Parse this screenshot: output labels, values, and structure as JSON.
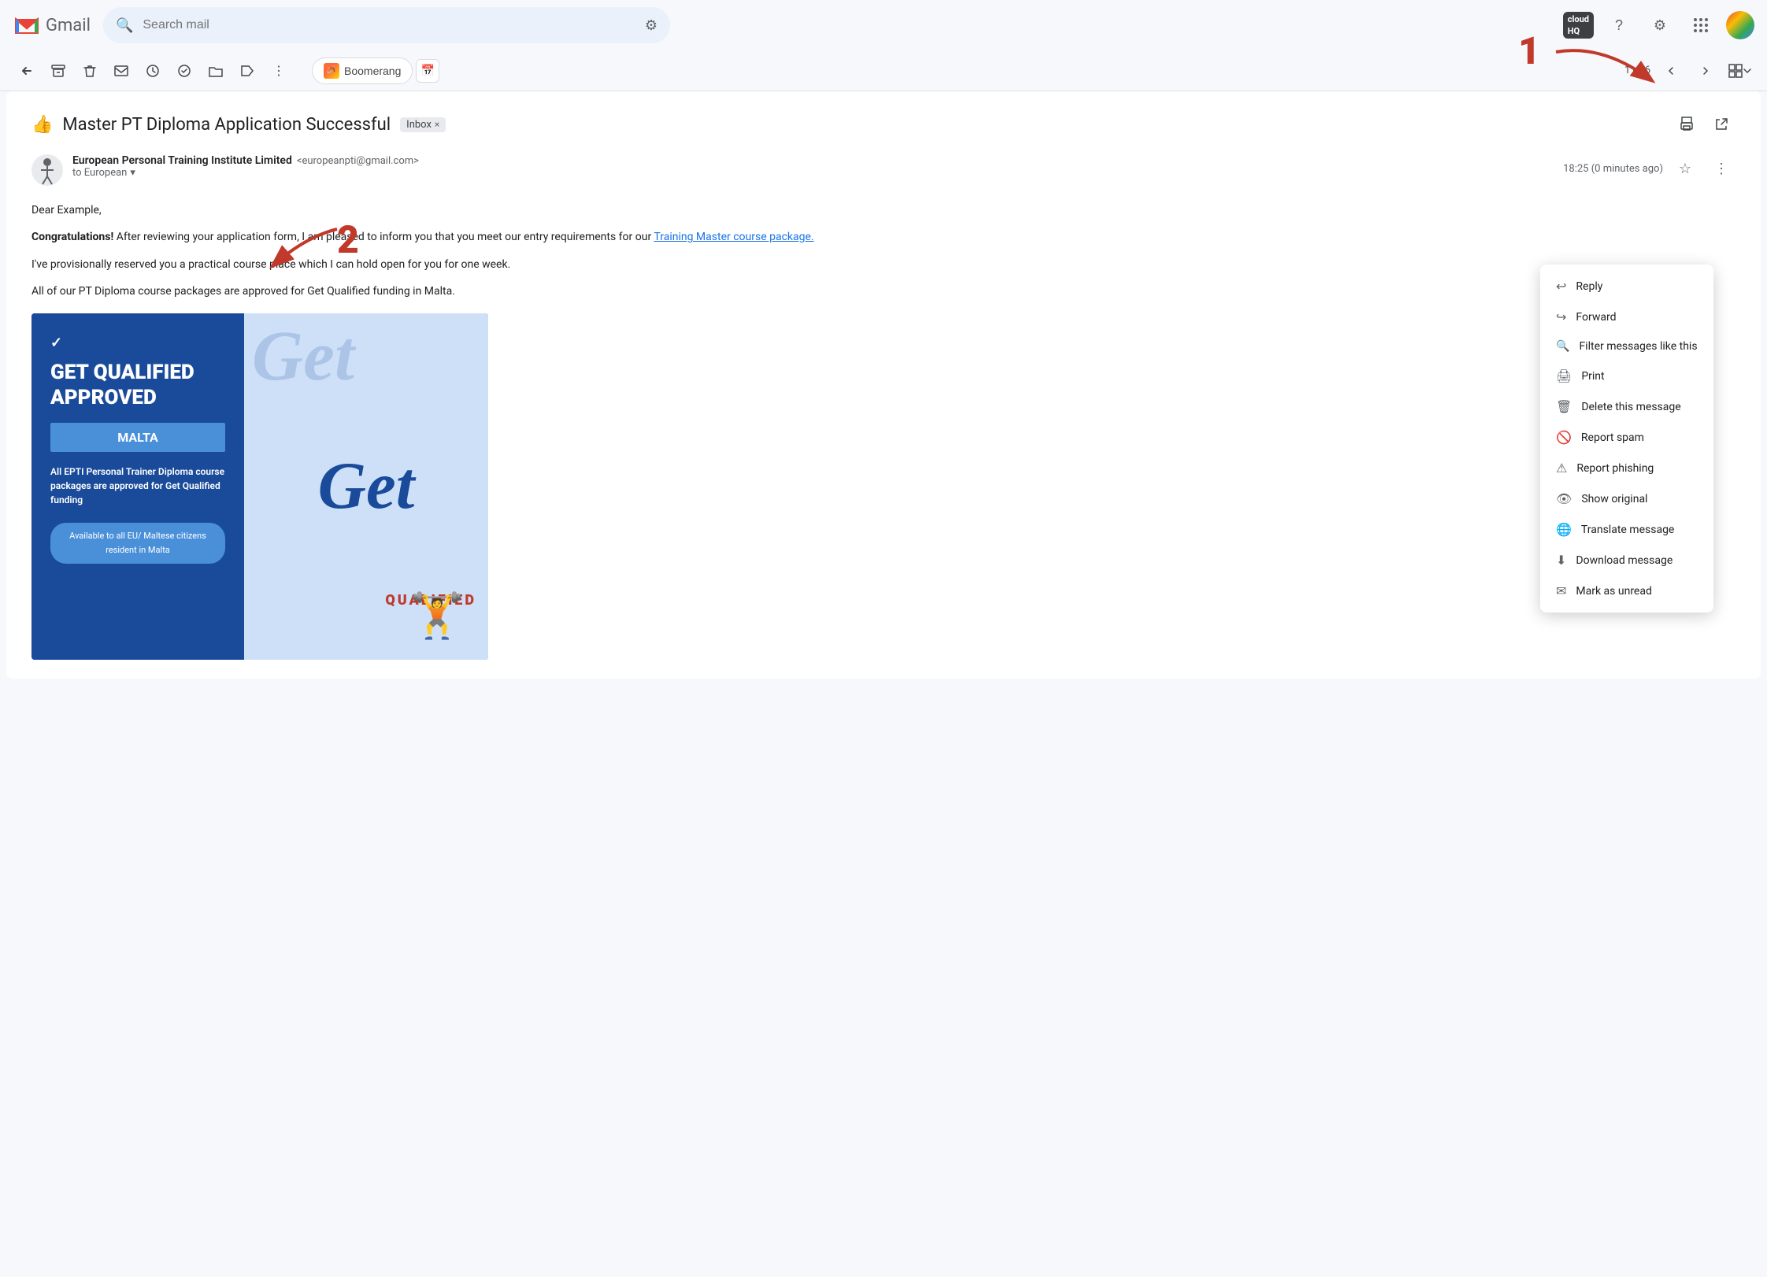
{
  "app": {
    "name": "Gmail",
    "logo_text": "Gmail"
  },
  "topbar": {
    "search_placeholder": "Search mail",
    "cloud_hq_label": "cloud\nHQ",
    "help_icon": "?",
    "settings_icon": "⚙",
    "waffle_icon": "⋮⋮⋮"
  },
  "toolbar": {
    "back_label": "←",
    "archive_label": "🗄",
    "delete_label": "🗑",
    "unread_label": "✉",
    "snooze_label": "🕐",
    "task_label": "✓",
    "move_label": "📁",
    "label_label": "🏷",
    "more_label": "⋮",
    "boomerang_label": "Boomerang",
    "calendar_label": "📅",
    "page_count": "1 of 6",
    "prev_label": "<",
    "next_label": ">",
    "view_label": "▦"
  },
  "email": {
    "emoji": "👍",
    "subject": "Master PT Diploma Application Successful",
    "inbox_badge": "Inbox",
    "sender_name": "European Personal Training Institute Limited",
    "sender_email": "<europeanpti@gmail.com>",
    "to_label": "to European",
    "timestamp": "18:25 (0 minutes ago)",
    "body_greeting": "Dear Example,",
    "body_bold": "Congratulations!",
    "body_after_bold": " After reviewing your application form, I am pleased to inform you that you meet our entry requirements for our ",
    "body_link": "Training Master course package.",
    "body_para2": "I've provisionally reserved you a practical course place which I can hold open for you for one week.",
    "body_para3": "All of our PT Diploma course packages are approved for Get Qualified funding in Malta.",
    "banner": {
      "check": "✓",
      "title": "GET QUALIFIED APPROVED",
      "malta": "MALTA",
      "desc": "All EPTI Personal Trainer Diploma course packages are approved for Get Qualified funding",
      "eu_btn": "Available to all EU/ Maltese citizens resident in Malta",
      "script_text": "Get",
      "qualified_text": "QUALIFIED"
    }
  },
  "dropdown": {
    "items": [
      {
        "icon": "↩",
        "label": "Reply"
      },
      {
        "icon": "↪",
        "label": "Forward"
      },
      {
        "icon": "🔍",
        "label": "Filter messages like this"
      },
      {
        "icon": "🖨",
        "label": "Print"
      },
      {
        "icon": "🗑",
        "label": "Delete this message"
      },
      {
        "icon": "🚫",
        "label": "Report spam"
      },
      {
        "icon": "⚠",
        "label": "Report phishing"
      },
      {
        "icon": "👁",
        "label": "Show original"
      },
      {
        "icon": "🌐",
        "label": "Translate message"
      },
      {
        "icon": "⬇",
        "label": "Download message"
      },
      {
        "icon": "✉",
        "label": "Mark as unread"
      }
    ]
  },
  "annotations": {
    "num1": "1",
    "num2": "2"
  }
}
